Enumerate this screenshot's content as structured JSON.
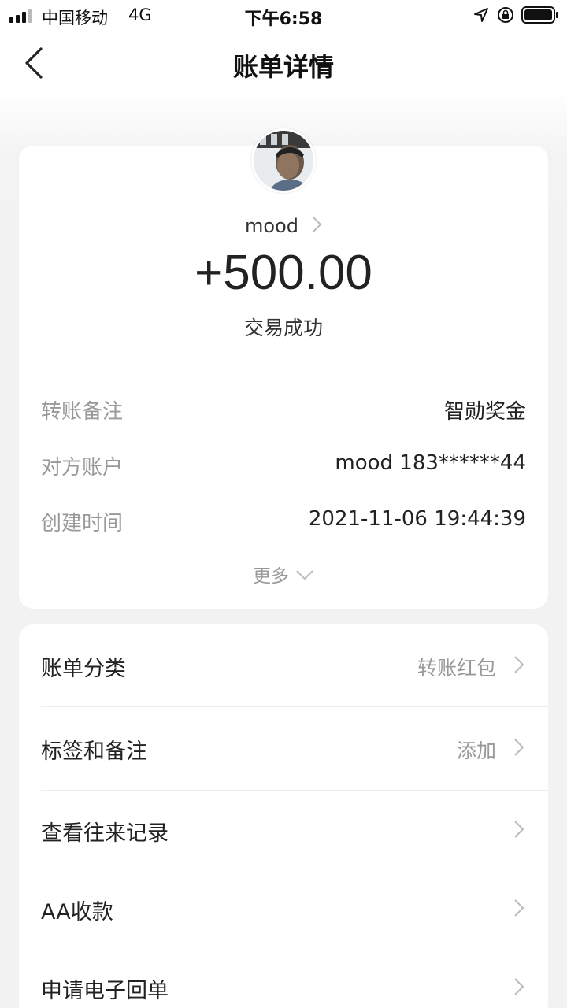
{
  "status_bar": {
    "carrier": "中国移动",
    "network": "4G",
    "time": "下午6:58"
  },
  "nav": {
    "title": "账单详情",
    "back_icon": "chevron-left-icon"
  },
  "summary": {
    "name": "mood",
    "amount": "+500.00",
    "status": "交易成功",
    "rows": [
      {
        "label": "转账备注",
        "value": "智勋奖金"
      },
      {
        "label": "对方账户",
        "value": "mood 183******44"
      },
      {
        "label": "创建时间",
        "value": "2021-11-06 19:44:39"
      }
    ],
    "more": "更多"
  },
  "menu": [
    {
      "label": "账单分类",
      "value": "转账红包"
    },
    {
      "label": "标签和备注",
      "value": "添加"
    },
    {
      "label": "查看往来记录",
      "value": ""
    },
    {
      "label": "AA收款",
      "value": ""
    },
    {
      "label": "申请电子回单",
      "value": ""
    }
  ],
  "colors": {
    "background": "#f2f2f2",
    "card": "#ffffff",
    "muted_text": "#999999"
  }
}
